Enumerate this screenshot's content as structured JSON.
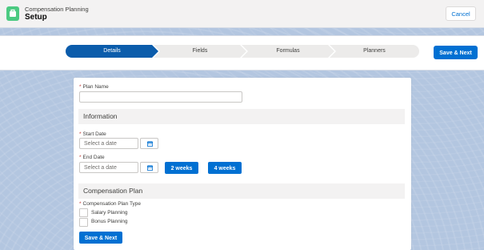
{
  "header": {
    "app_name": "Compensation Planning",
    "title": "Setup",
    "cancel_label": "Cancel",
    "icon": "briefcase-icon"
  },
  "path": {
    "steps": [
      {
        "label": "Details",
        "active": true
      },
      {
        "label": "Fields",
        "active": false
      },
      {
        "label": "Formulas",
        "active": false
      },
      {
        "label": "Planners",
        "active": false
      }
    ],
    "save_next_label": "Save & Next"
  },
  "form": {
    "plan_name": {
      "required_mark": "*",
      "label": "Plan Name",
      "value": ""
    },
    "information": {
      "title": "Information",
      "start_date": {
        "required_mark": "*",
        "label": "Start Date",
        "placeholder": "Select a date"
      },
      "end_date": {
        "required_mark": "*",
        "label": "End Date",
        "placeholder": "Select a date"
      },
      "two_weeks_label": "2 weeks",
      "four_weeks_label": "4 weeks"
    },
    "compensation_plan": {
      "title": "Compensation Plan",
      "type": {
        "required_mark": "*",
        "label": "Compensation Plan Type"
      },
      "options": [
        {
          "label": "Salary Planning",
          "checked": false
        },
        {
          "label": "Bonus Planning",
          "checked": false
        }
      ]
    },
    "save_next_label": "Save & Next"
  },
  "colors": {
    "brand": "#0070d2",
    "path_active": "#0b5cab",
    "path_inactive": "#ecebea",
    "app_icon": "#4bca81",
    "required": "#c23934"
  }
}
